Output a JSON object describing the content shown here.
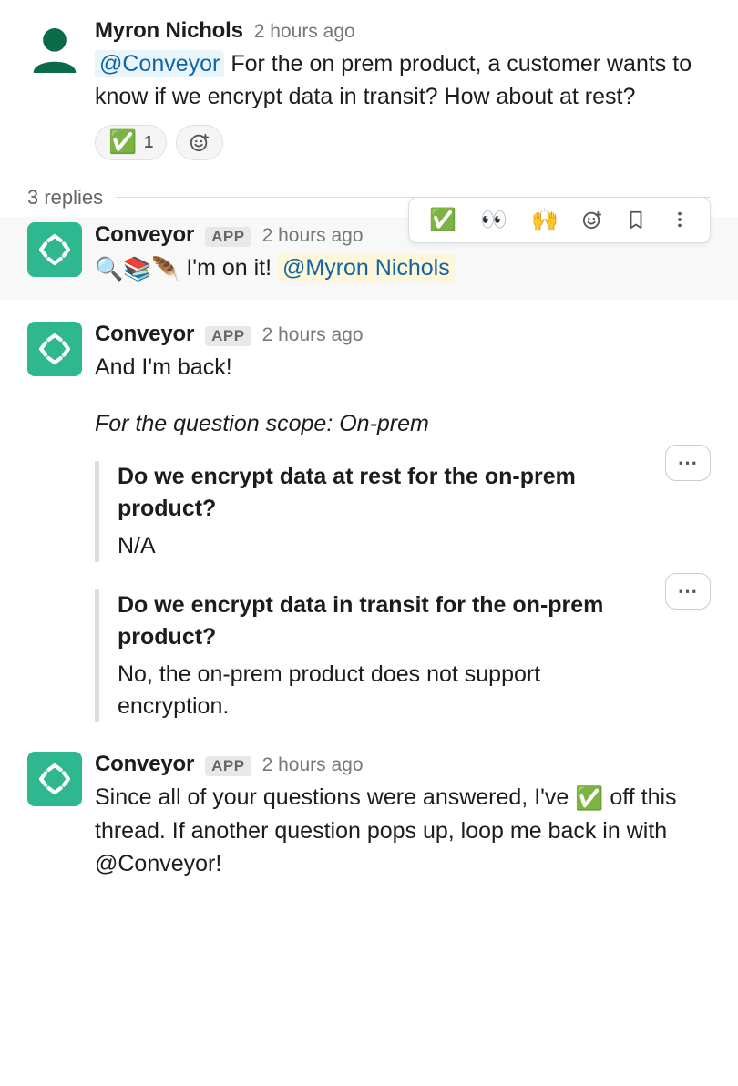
{
  "main_message": {
    "author": "Myron Nichols",
    "timestamp": "2 hours ago",
    "mention": "@Conveyor",
    "text_after_mention": " For the on prem product, a customer wants to know if we encrypt data in transit? How about at rest?",
    "reaction_emoji": "✅",
    "reaction_count": "1"
  },
  "replies_label": "3 replies",
  "hover_actions": {
    "check": "✅",
    "eyes": "👀",
    "hands": "🙌"
  },
  "reply1": {
    "author": "Conveyor",
    "badge": "APP",
    "timestamp": "2 hours ago",
    "pre_emojis": "🔍📚🪶 ",
    "text": "I'm on it! ",
    "mention": "@Myron Nichols"
  },
  "reply2": {
    "author": "Conveyor",
    "badge": "APP",
    "timestamp": "2 hours ago",
    "line1": "And I'm back!",
    "scope_line": "For the question scope: On-prem",
    "q1_title": "Do we encrypt data at rest for the on-prem product?",
    "q1_answer": "N/A",
    "q2_title": "Do we encrypt data in transit for the on-prem product?",
    "q2_answer": "No, the on-prem product does not support encryption."
  },
  "reply3": {
    "author": "Conveyor",
    "badge": "APP",
    "timestamp": "2 hours ago",
    "part1": "Since all of your questions were answered, I've ",
    "emoji": "✅",
    "part2": " off this thread. If another question pops up, loop me back in with @Conveyor!"
  },
  "more_dots": "⋯"
}
